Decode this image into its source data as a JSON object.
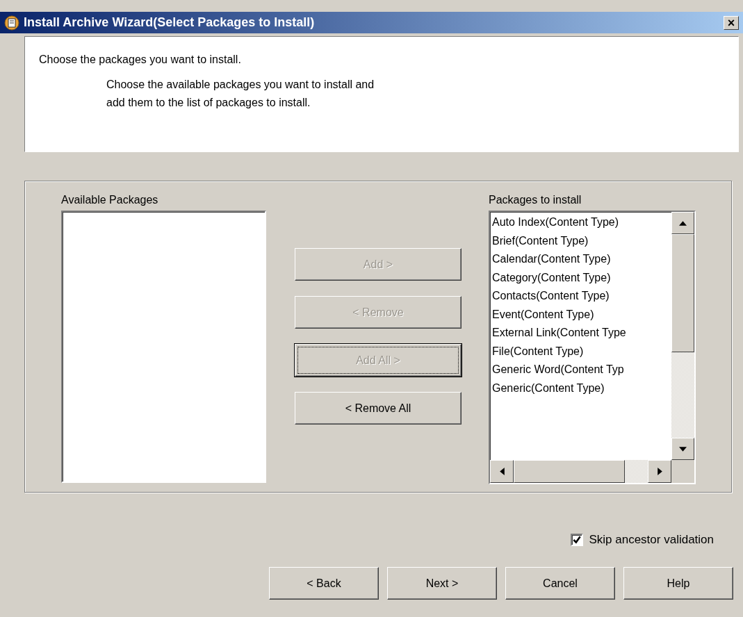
{
  "window": {
    "title": "Install Archive Wizard(Select Packages to Install)",
    "close": "×"
  },
  "header": {
    "heading": "Choose the packages you want to install.",
    "description_lines": [
      "Choose the available packages you want to install and",
      "add them to the list of packages to install."
    ]
  },
  "available": {
    "label": "Available Packages"
  },
  "transfer_buttons": [
    {
      "label": "Add >",
      "disabled": true,
      "focused": false
    },
    {
      "label": "< Remove",
      "disabled": true,
      "focused": false
    },
    {
      "label": "Add All >",
      "disabled": true,
      "focused": true
    },
    {
      "label": "< Remove All",
      "disabled": false,
      "focused": false
    }
  ],
  "to_install": {
    "label": "Packages to install",
    "items": [
      "Auto Index(Content Type)",
      "Brief(Content Type)",
      "Calendar(Content Type)",
      "Category(Content Type)",
      "Contacts(Content Type)",
      "Event(Content Type)",
      "External Link(Content Type",
      "File(Content Type)",
      "Generic Word(Content Typ",
      "Generic(Content Type)"
    ]
  },
  "skip_validation": {
    "label": "Skip ancestor validation",
    "checked": true
  },
  "nav_buttons": [
    {
      "label": "< Back"
    },
    {
      "label": "Next >"
    },
    {
      "label": "Cancel"
    },
    {
      "label": "Help"
    }
  ]
}
